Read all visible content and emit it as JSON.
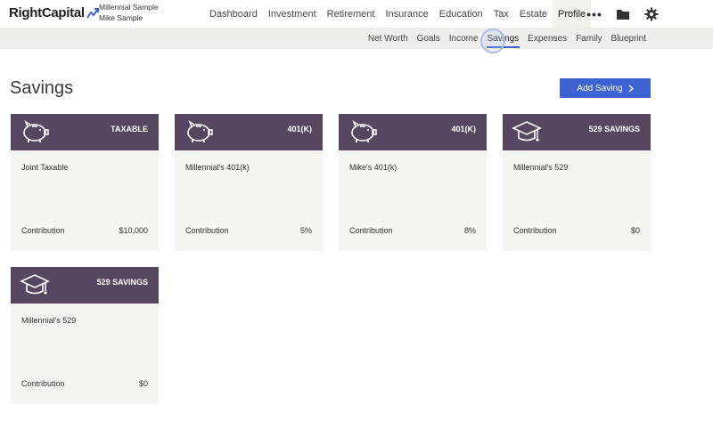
{
  "app": {
    "logo_text": "RightCapital",
    "client_primary": "Millennial Sample",
    "client_secondary": "Mike Sample"
  },
  "nav": {
    "items": [
      "Dashboard",
      "Investment",
      "Retirement",
      "Insurance",
      "Education",
      "Tax",
      "Estate",
      "Profile"
    ],
    "active": "Profile"
  },
  "subnav": {
    "items": [
      "Net Worth",
      "Goals",
      "Income",
      "Savings",
      "Expenses",
      "Family",
      "Blueprint"
    ],
    "active": "Savings"
  },
  "page": {
    "title": "Savings",
    "add_button": "Add Saving"
  },
  "cards": [
    {
      "type": "TAXABLE",
      "name": "Joint Taxable",
      "contribution_label": "Contribution",
      "contribution": "$10,000",
      "icon": "piggy-bank-icon"
    },
    {
      "type": "401(K)",
      "name": "Millennial's 401(k)",
      "contribution_label": "Contribution",
      "contribution": "5%",
      "icon": "piggy-bank-icon"
    },
    {
      "type": "401(K)",
      "name": "Mike's 401(k)",
      "contribution_label": "Contribution",
      "contribution": "8%",
      "icon": "piggy-bank-icon"
    },
    {
      "type": "529 SAVINGS",
      "name": "Millennial's 529",
      "contribution_label": "Contribution",
      "contribution": "$0",
      "icon": "graduation-cap-icon"
    },
    {
      "type": "529 SAVINGS",
      "name": "Millennial's 529",
      "contribution_label": "Contribution",
      "contribution": "$0",
      "icon": "graduation-cap-icon"
    }
  ],
  "colors": {
    "card_header": "#574660",
    "card_body": "#f7f5f1",
    "accent": "#3d63d3",
    "subnav_bg": "#efeeea"
  }
}
